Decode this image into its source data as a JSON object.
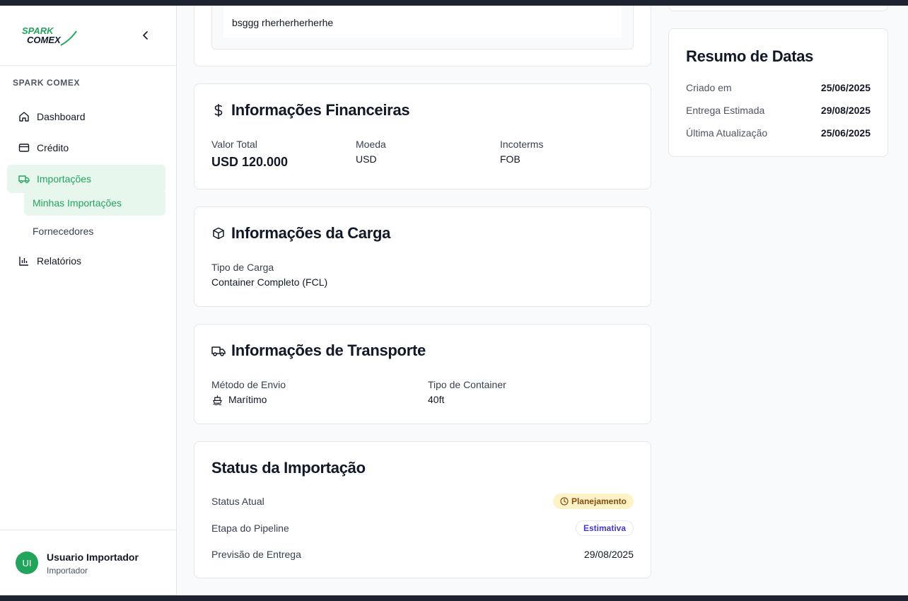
{
  "sidebar": {
    "logo_text_1": "SPARK",
    "logo_text_2": "COMEX",
    "section_label": "SPARK COMEX",
    "items": [
      {
        "label": "Dashboard",
        "icon": "home-icon"
      },
      {
        "label": "Crédito",
        "icon": "credit-card-icon"
      },
      {
        "label": "Importações",
        "icon": "truck-icon"
      },
      {
        "label": "Relatórios",
        "icon": "bar-chart-icon"
      }
    ],
    "subitems": [
      {
        "label": "Minhas Importações"
      },
      {
        "label": "Fornecedores"
      }
    ],
    "user": {
      "initials": "UI",
      "name": "Usuario Importador",
      "role": "Importador"
    }
  },
  "description": {
    "text": "bsggg rherherherherhe"
  },
  "financial": {
    "title": "Informações Financeiras",
    "fields": [
      {
        "label": "Valor Total",
        "value": "USD 120.000"
      },
      {
        "label": "Moeda",
        "value": "USD"
      },
      {
        "label": "Incoterms",
        "value": "FOB"
      }
    ]
  },
  "cargo": {
    "title": "Informações da Carga",
    "fields": [
      {
        "label": "Tipo de Carga",
        "value": "Container Completo (FCL)"
      }
    ]
  },
  "transport": {
    "title": "Informações de Transporte",
    "fields": [
      {
        "label": "Método de Envio",
        "value": "Marítimo"
      },
      {
        "label": "Tipo de Container",
        "value": "40ft"
      }
    ]
  },
  "status": {
    "title": "Status da Importação",
    "rows": [
      {
        "label": "Status Atual",
        "value": "Planejamento"
      },
      {
        "label": "Etapa do Pipeline",
        "value": "Estimativa"
      },
      {
        "label": "Previsão de Entrega",
        "value": "29/08/2025"
      }
    ]
  },
  "dates": {
    "title": "Resumo de Datas",
    "rows": [
      {
        "label": "Criado em",
        "value": "25/06/2025"
      },
      {
        "label": "Entrega Estimada",
        "value": "29/08/2025"
      },
      {
        "label": "Última Atualização",
        "value": "25/06/2025"
      }
    ]
  },
  "colors": {
    "accent": "#22a45d",
    "accent_bg": "#e8f7ee",
    "badge_yellow": "#fef3c7"
  }
}
